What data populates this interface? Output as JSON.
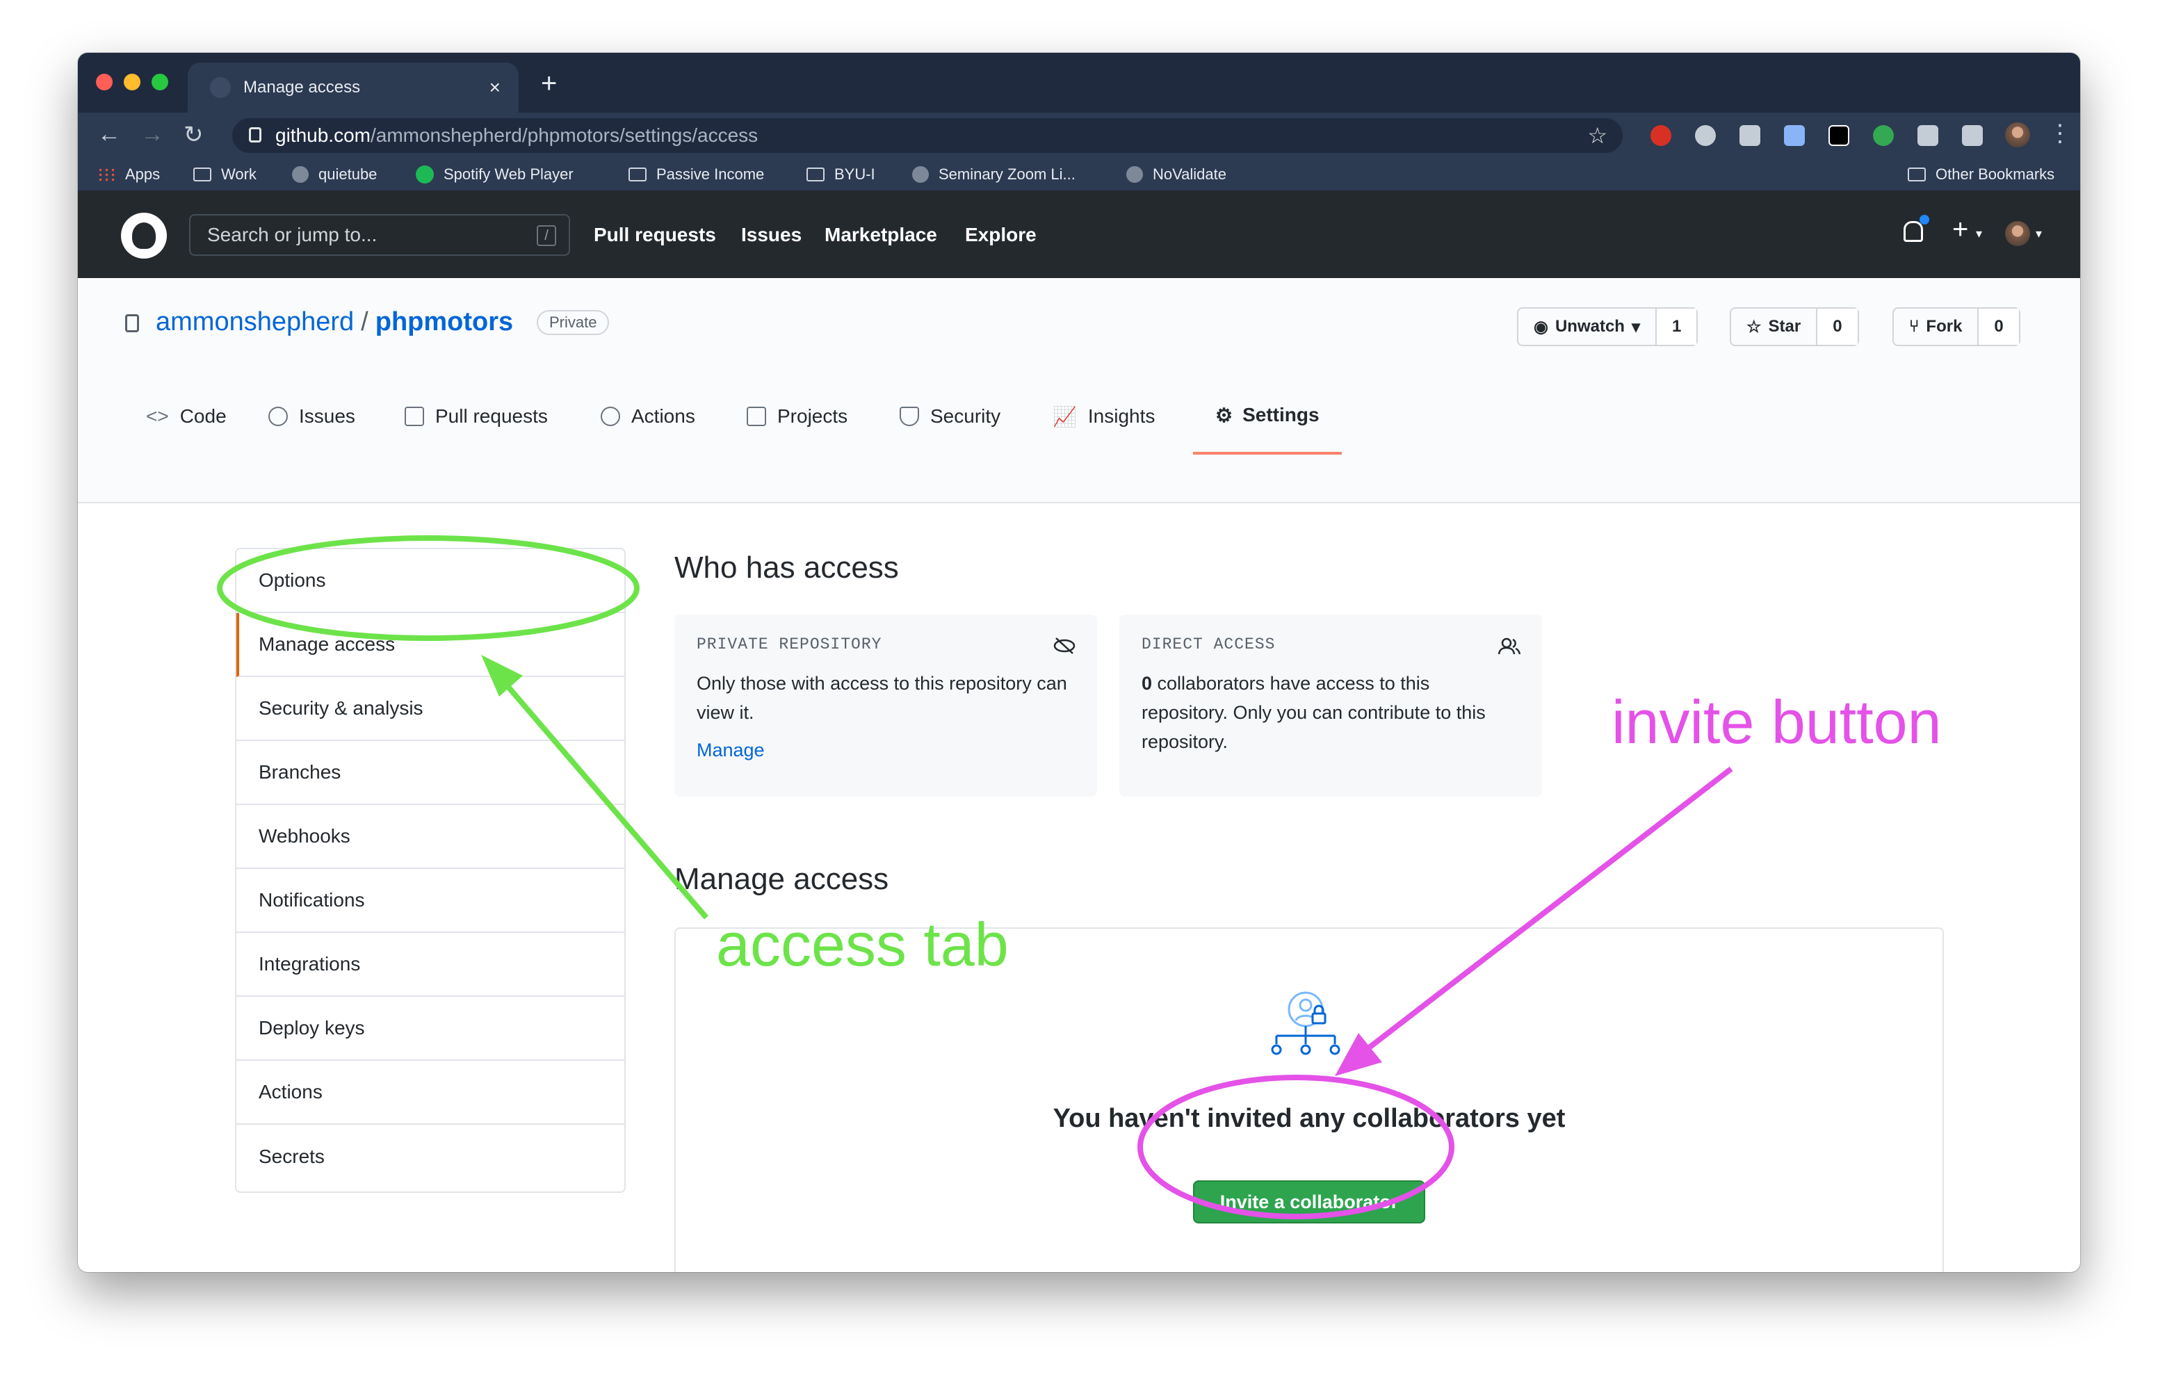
{
  "browser": {
    "tab_title": "Manage access",
    "tab_close": "×",
    "new_tab": "+",
    "url_host": "github.com",
    "url_path": "/ammonshepherd/phpmotors/settings/access",
    "bookmarks": [
      "Apps",
      "Work",
      "quietube",
      "Spotify Web Player",
      "Passive Income",
      "BYU-I",
      "Seminary Zoom Li...",
      "NoValidate"
    ],
    "other_bookmarks": "Other Bookmarks"
  },
  "github": {
    "search_placeholder": "Search or jump to...",
    "search_hint": "/",
    "nav": [
      "Pull requests",
      "Issues",
      "Marketplace",
      "Explore"
    ]
  },
  "repo": {
    "owner": "ammonshepherd",
    "separator": "/",
    "name": "phpmotors",
    "visibility": "Private",
    "watch_label": "Unwatch",
    "watch_count": "1",
    "star_label": "Star",
    "star_count": "0",
    "fork_label": "Fork",
    "fork_count": "0",
    "tabs": [
      "Code",
      "Issues",
      "Pull requests",
      "Actions",
      "Projects",
      "Security",
      "Insights",
      "Settings"
    ],
    "active_tab": "Settings"
  },
  "settings_menu": {
    "items": [
      "Options",
      "Manage access",
      "Security & analysis",
      "Branches",
      "Webhooks",
      "Notifications",
      "Integrations",
      "Deploy keys",
      "Actions",
      "Secrets"
    ],
    "selected": "Manage access"
  },
  "who_has_access": {
    "title": "Who has access",
    "private_card": {
      "caption": "PRIVATE REPOSITORY",
      "text": "Only those with access to this repository can view it.",
      "link": "Manage"
    },
    "direct_card": {
      "caption": "DIRECT ACCESS",
      "count": "0",
      "text": " collaborators have access to this repository. Only you can contribute to this repository."
    }
  },
  "manage_access": {
    "title": "Manage access",
    "empty_message": "You haven't invited any collaborators yet",
    "invite_button": "Invite a collaborator"
  },
  "annotations": {
    "access_label": "access tab",
    "invite_label": "invite button",
    "access_color": "#6de34a",
    "invite_color": "#e452e8"
  },
  "colors": {
    "link": "#0366d6",
    "primary_button": "#2ea44f",
    "active_tab_underline": "#f9826c",
    "header_bg": "#24292e"
  }
}
